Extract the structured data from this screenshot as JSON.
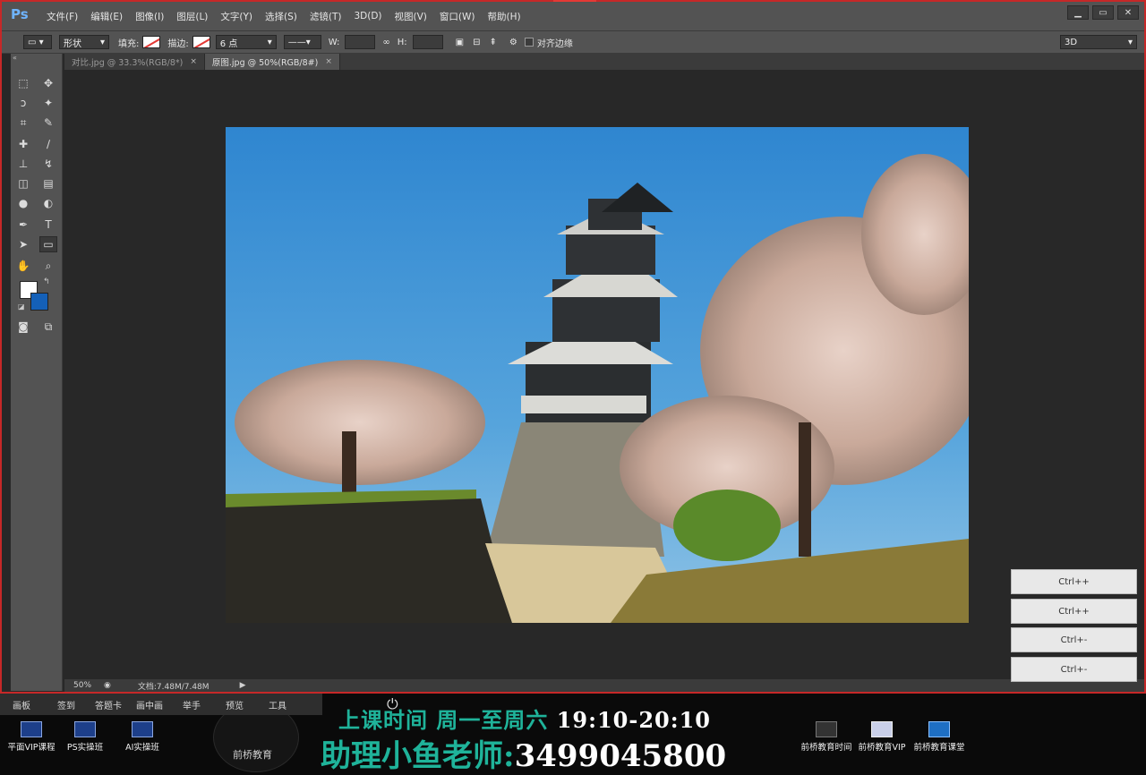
{
  "app": {
    "logo": "Ps"
  },
  "menu": [
    "文件(F)",
    "编辑(E)",
    "图像(I)",
    "图层(L)",
    "文字(Y)",
    "选择(S)",
    "滤镜(T)",
    "3D(D)",
    "视图(V)",
    "窗口(W)",
    "帮助(H)"
  ],
  "window_controls": {
    "minimize": "▁",
    "restore": "▭",
    "close": "✕"
  },
  "options": {
    "mode": "形状",
    "fill_label": "填充:",
    "stroke_label": "描边:",
    "stroke_size": "6 点",
    "w_label": "W:",
    "h_label": "H:",
    "align_edges": "对齐边缘",
    "workspace": "3D"
  },
  "tabs": [
    {
      "label": "对比.jpg @ 33.3%(RGB/8*)",
      "close": "×"
    },
    {
      "label": "原图.jpg @ 50%(RGB/8#)",
      "close": "×"
    }
  ],
  "status": {
    "zoom": "50%",
    "doc": "文档:7.48M/7.48M"
  },
  "ctrl_buttons": [
    "Ctrl++",
    "Ctrl++",
    "Ctrl+-",
    "Ctrl+-"
  ],
  "taskbar": [
    "画板",
    "签到",
    "答题卡",
    "画中画",
    "举手",
    "预览",
    "工具"
  ],
  "banner": {
    "line1_label": "上课时间 周一至周六",
    "line1_time": "19:10-20:10",
    "line2_label": "助理小鱼老师:",
    "line2_phone": "3499045800",
    "logo_label": "前桥教育"
  },
  "desktop_icons_left": [
    "平面VIP课程",
    "PS实操班",
    "AI实操班"
  ],
  "desktop_icons_right": [
    "前桥教育时间",
    "前桥教育VIP",
    "前桥教育课堂"
  ],
  "colors": {
    "foreground": "#ffffff",
    "background": "#1460b8",
    "accent": "#1fb39a"
  }
}
